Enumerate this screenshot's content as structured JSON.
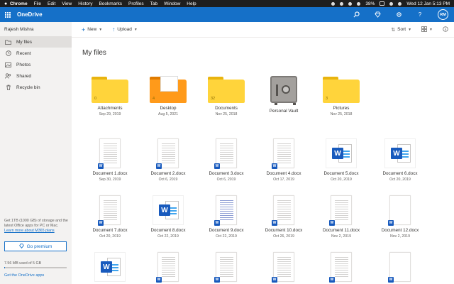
{
  "mac": {
    "app": "Chrome",
    "menus": [
      "File",
      "Edit",
      "View",
      "History",
      "Bookmarks",
      "Profiles",
      "Tab",
      "Window",
      "Help"
    ],
    "battery": "38%",
    "clock": "Wed 12 Jan  5:13 PM"
  },
  "header": {
    "title": "OneDrive",
    "avatar_initials": "RM"
  },
  "sidebar": {
    "user": "Rajesh Mishra",
    "items": [
      {
        "label": "My files",
        "icon": "folder-icon"
      },
      {
        "label": "Recent",
        "icon": "clock-icon"
      },
      {
        "label": "Photos",
        "icon": "photo-icon"
      },
      {
        "label": "Shared",
        "icon": "people-icon"
      },
      {
        "label": "Recycle bin",
        "icon": "trash-icon"
      }
    ],
    "promo_text": "Get 1TB (1000 GB) of storage and the latest Office apps for PC or Mac.",
    "promo_link": "Learn more about M365 plans",
    "premium_label": "Go premium",
    "storage_text": "7.56 MB used of 5 GB",
    "storage_fraction": 0.0015,
    "apps_link": "Get the OneDrive apps"
  },
  "cmdbar": {
    "new_label": "New",
    "upload_label": "Upload",
    "sort_label": "Sort"
  },
  "main": {
    "title": "My files",
    "folders": [
      {
        "name": "Attachments",
        "date": "Sep 29, 2019",
        "count": "0"
      },
      {
        "name": "Desktop",
        "date": "Aug 5, 2021",
        "count": "4"
      },
      {
        "name": "Documents",
        "date": "Nov 25, 2018",
        "count": "32"
      },
      {
        "name": "Personal Vault",
        "date": ""
      },
      {
        "name": "Pictures",
        "date": "Nov 25, 2018",
        "count": "3"
      }
    ],
    "files": [
      {
        "name": "Document 1.docx",
        "date": "Sep 30, 2019"
      },
      {
        "name": "Document 2.docx",
        "date": "Oct 6, 2019"
      },
      {
        "name": "Document 3.docx",
        "date": "Oct 6, 2019"
      },
      {
        "name": "Document 4.docx",
        "date": "Oct 17, 2019"
      },
      {
        "name": "Document 5.docx",
        "date": "Oct 20, 2019"
      },
      {
        "name": "Document 6.docx",
        "date": "Oct 20, 2019"
      },
      {
        "name": "Document 7.docx",
        "date": "Oct 20, 2019"
      },
      {
        "name": "Document 8.docx",
        "date": "Oct 22, 2019"
      },
      {
        "name": "Document 9.docx",
        "date": "Oct 22, 2019"
      },
      {
        "name": "Document 10.docx",
        "date": "Oct 26, 2019"
      },
      {
        "name": "Document 11.docx",
        "date": "Nov 2, 2019"
      },
      {
        "name": "Document 12.docx",
        "date": "Nov 2, 2019"
      }
    ]
  },
  "colors": {
    "brand": "#1570c8",
    "folder": "#ffd43b",
    "word": "#185abd"
  }
}
